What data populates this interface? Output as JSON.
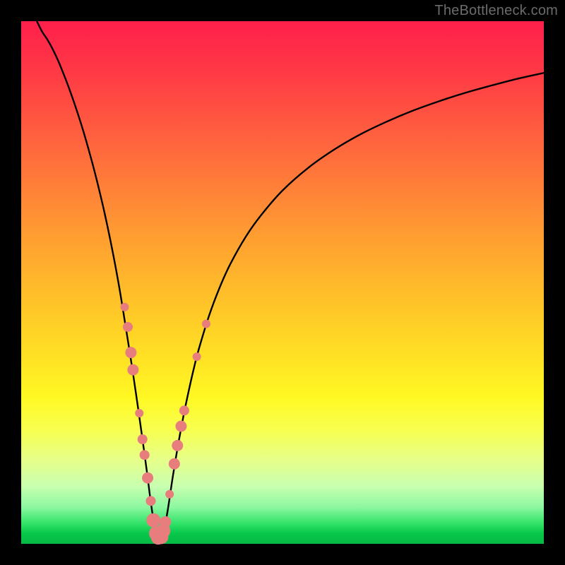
{
  "watermark": "TheBottleneck.com",
  "colors": {
    "frame": "#000000",
    "curve": "#000000",
    "marker_fill": "#e77d7d",
    "marker_stroke": "#cf6262"
  },
  "chart_data": {
    "type": "line",
    "title": "",
    "xlabel": "",
    "ylabel": "",
    "xlim": [
      0,
      100
    ],
    "ylim": [
      0,
      100
    ],
    "grid": false,
    "legend": false,
    "notch_x": 26,
    "series": [
      {
        "name": "bottleneck-curve",
        "x": [
          3,
          4,
          5,
          6,
          7,
          8,
          9,
          10,
          11,
          12,
          13,
          14,
          15,
          16,
          17,
          18,
          19,
          20,
          21,
          22,
          23,
          24,
          25,
          26,
          27,
          28,
          29,
          30,
          31,
          32,
          33,
          34,
          36,
          38,
          40,
          43,
          46,
          50,
          55,
          60,
          65,
          70,
          75,
          80,
          85,
          90,
          95,
          100
        ],
        "y": [
          100,
          98,
          96.5,
          94.7,
          92.6,
          90.2,
          87.6,
          84.8,
          81.8,
          78.6,
          75.1,
          71.4,
          67.4,
          63.1,
          58.4,
          53.3,
          47.7,
          41.5,
          35.2,
          28.5,
          21.5,
          14.2,
          6.6,
          1.2,
          1.2,
          6.2,
          12.8,
          18.8,
          24.2,
          29,
          33.4,
          37.3,
          43.8,
          49.1,
          53.5,
          58.8,
          63,
          67.6,
          72,
          75.5,
          78.4,
          80.8,
          82.9,
          84.7,
          86.3,
          87.7,
          89,
          90.1
        ]
      }
    ],
    "markers": [
      {
        "x": 19.8,
        "y": 45.3,
        "r": 6
      },
      {
        "x": 20.4,
        "y": 41.5,
        "r": 7
      },
      {
        "x": 21.0,
        "y": 36.6,
        "r": 8
      },
      {
        "x": 21.4,
        "y": 33.3,
        "r": 8
      },
      {
        "x": 22.6,
        "y": 25.0,
        "r": 6
      },
      {
        "x": 23.2,
        "y": 20.0,
        "r": 7
      },
      {
        "x": 23.6,
        "y": 17.0,
        "r": 7
      },
      {
        "x": 24.2,
        "y": 12.6,
        "r": 8
      },
      {
        "x": 24.8,
        "y": 8.2,
        "r": 7
      },
      {
        "x": 25.3,
        "y": 4.5,
        "r": 10
      },
      {
        "x": 25.8,
        "y": 2.0,
        "r": 10
      },
      {
        "x": 26.2,
        "y": 1.2,
        "r": 10
      },
      {
        "x": 26.8,
        "y": 1.3,
        "r": 10
      },
      {
        "x": 27.2,
        "y": 2.5,
        "r": 10
      },
      {
        "x": 27.6,
        "y": 4.2,
        "r": 8
      },
      {
        "x": 28.4,
        "y": 9.5,
        "r": 6
      },
      {
        "x": 29.3,
        "y": 15.3,
        "r": 8
      },
      {
        "x": 29.9,
        "y": 18.8,
        "r": 8
      },
      {
        "x": 30.6,
        "y": 22.5,
        "r": 8
      },
      {
        "x": 31.2,
        "y": 25.5,
        "r": 7
      },
      {
        "x": 33.6,
        "y": 35.8,
        "r": 6
      },
      {
        "x": 35.4,
        "y": 42.1,
        "r": 6
      }
    ]
  }
}
